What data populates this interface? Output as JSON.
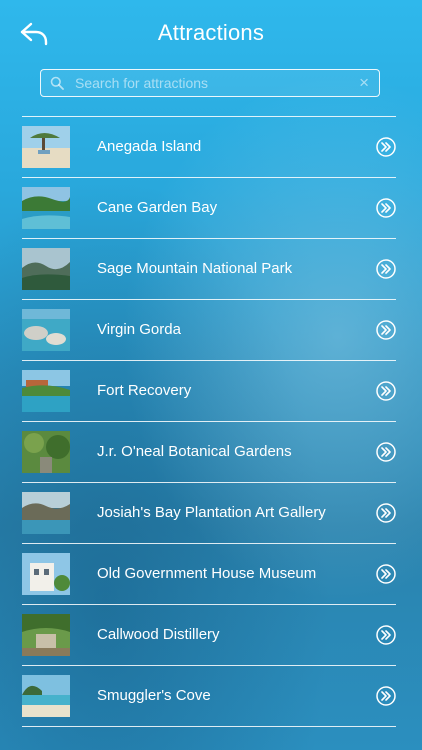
{
  "header": {
    "title": "Attractions",
    "back_icon": "back-arrow-icon"
  },
  "search": {
    "placeholder": "Search for attractions",
    "value": "",
    "clear_symbol": "×"
  },
  "attractions": [
    {
      "name": "Anegada Island"
    },
    {
      "name": "Cane Garden Bay"
    },
    {
      "name": "Sage Mountain National Park"
    },
    {
      "name": "Virgin Gorda"
    },
    {
      "name": "Fort Recovery"
    },
    {
      "name": "J.r. O'neal Botanical Gardens"
    },
    {
      "name": "Josiah's Bay Plantation Art Gallery"
    },
    {
      "name": "Old Government House Museum"
    },
    {
      "name": "Callwood Distillery"
    },
    {
      "name": "Smuggler's Cove"
    }
  ],
  "colors": {
    "background_top": "#2fb8ec",
    "background_bottom": "#2a83ae",
    "text": "#ffffff"
  }
}
